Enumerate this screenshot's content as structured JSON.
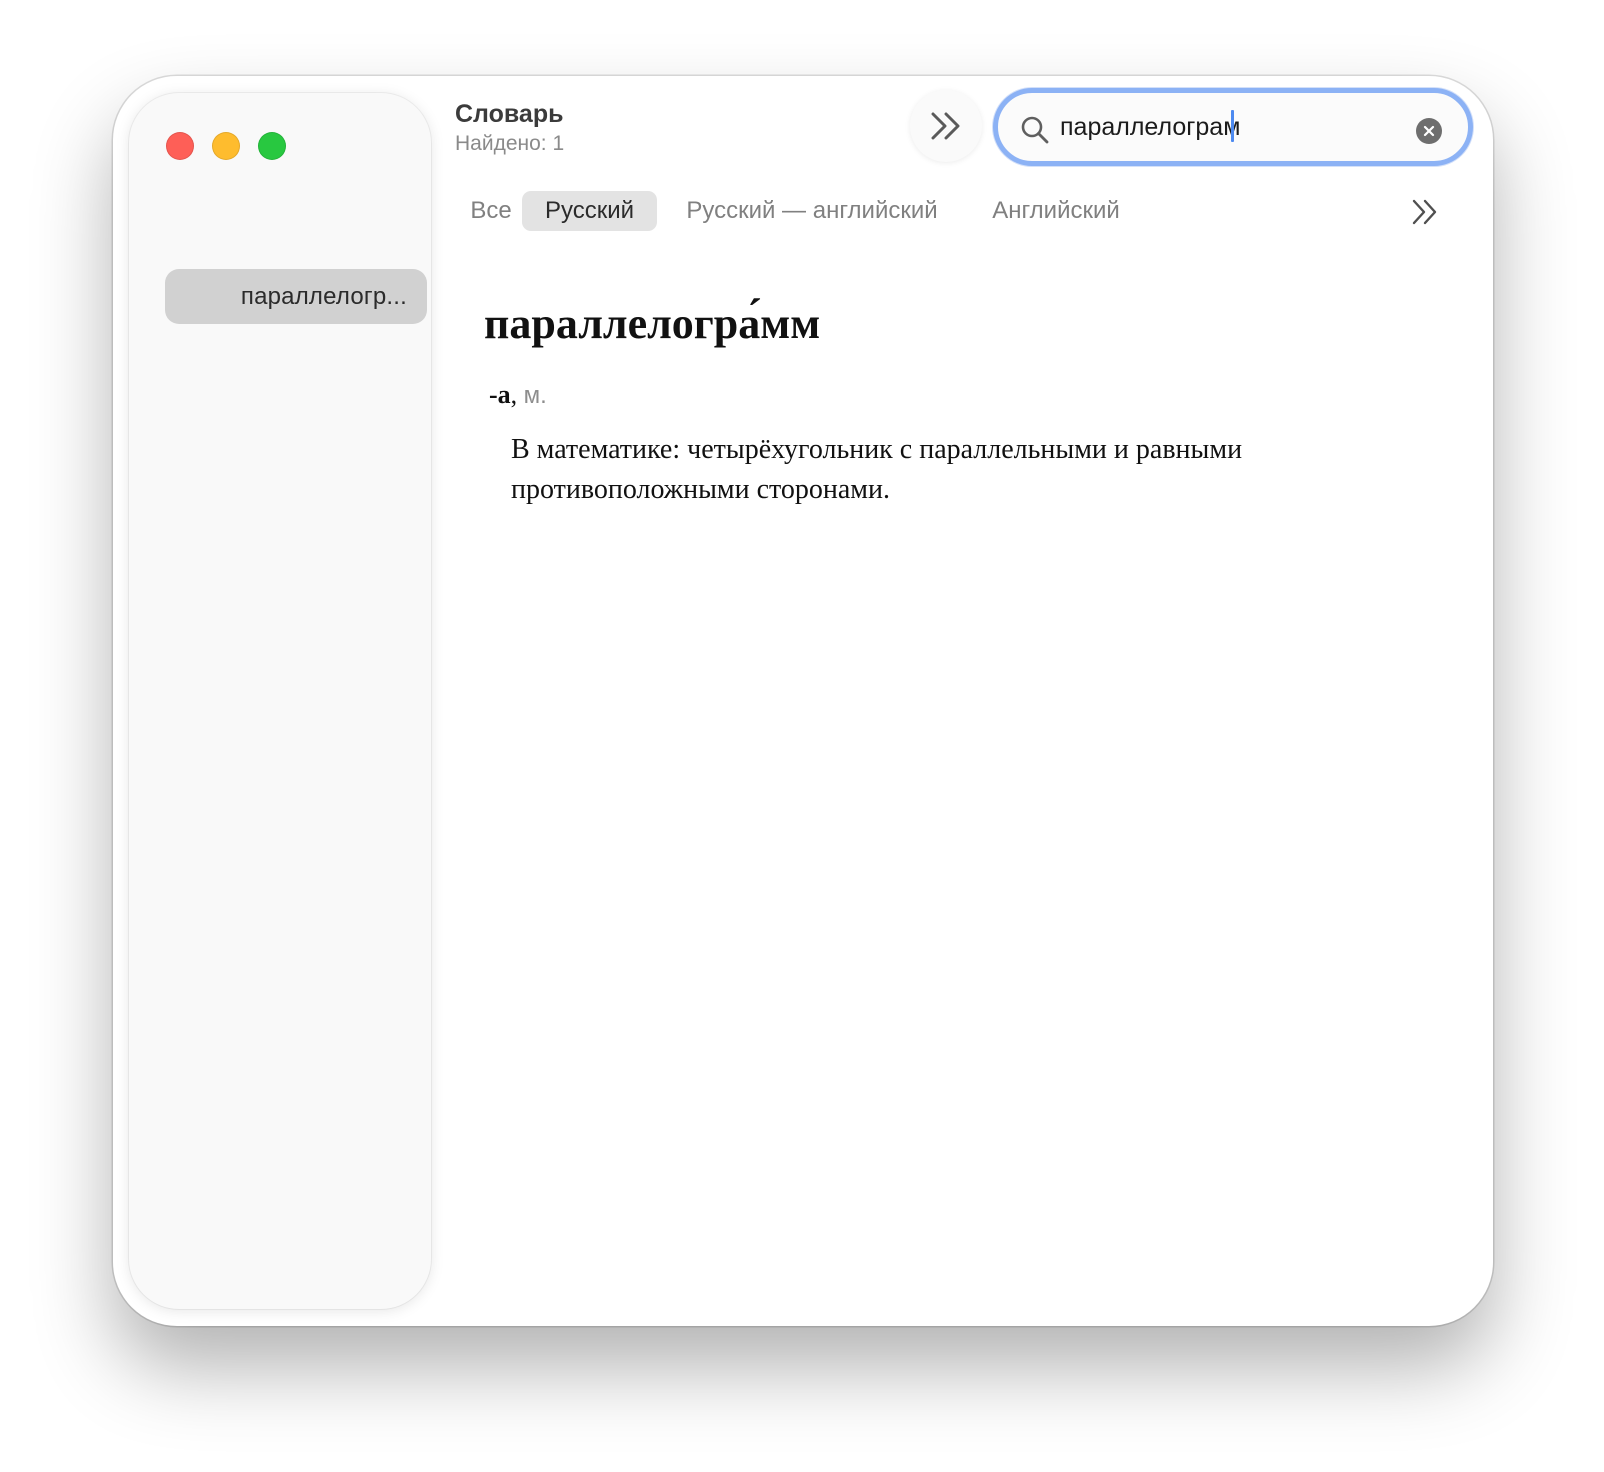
{
  "window": {
    "title": "Словарь",
    "subtitle": "Найдено: 1"
  },
  "sidebar": {
    "results": [
      {
        "label": "параллелогр..."
      }
    ]
  },
  "toolbar": {
    "more_icon": "double-chevron-right-icon"
  },
  "search": {
    "value": "параллелограм",
    "icon": "magnifying-glass-icon",
    "clear_icon": "clear-circle-x-icon"
  },
  "tabs": {
    "items": [
      {
        "label": "Все"
      },
      {
        "label": "Русский",
        "active": true
      },
      {
        "label": "Русский — английский"
      },
      {
        "label": "Английский"
      }
    ],
    "overflow_icon": "double-chevron-right-icon"
  },
  "entry": {
    "headword": "параллелогра́мм",
    "inflection": "-а",
    "separator": ",",
    "part_of_speech": "м.",
    "definition": "В математике: четырёхугольник с параллельными и равными противоположными сторонами."
  },
  "colors": {
    "close": "#fe5f57",
    "minimize": "#febc2e",
    "maximize": "#28c840",
    "focus_ring": "#8cb2f5",
    "selection": "#d1d1d1"
  }
}
